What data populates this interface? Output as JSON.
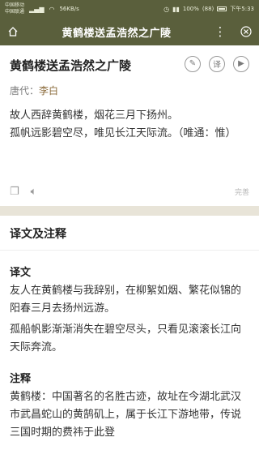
{
  "status_bar": {
    "carrier_1": "中国移动",
    "carrier_2": "中国联通",
    "speed": "56KB/s",
    "battery_text": "100%",
    "time": "下午5:33",
    "extra": "(88)"
  },
  "nav": {
    "title": "黄鹤楼送孟浩然之广陵",
    "home_icon": "home-icon",
    "more_icon": "more-vertical-icon",
    "close_icon": "close-icon"
  },
  "poem": {
    "title": "黄鹤楼送孟浩然之广陵",
    "author_label": "唐代：",
    "author": "李白",
    "body": [
      "故人西辞黄鹤楼，烟花三月下扬州。",
      "孤帆远影碧空尽，唯见长江天际流。（唯通：惟）"
    ],
    "actions": [
      "edit-icon",
      "translate-icon",
      "play-icon"
    ],
    "footer_note": "完善"
  },
  "translation": {
    "section_title": "译文及注释",
    "translation_label": "译文",
    "translation_text": "友人在黄鹤楼与我辞别，在柳絮如烟、繁花似锦的阳春三月去扬州远游。",
    "translation_text_2": "孤船帆影渐渐消失在碧空尽头，只看见滚滚长江向天际奔流。",
    "notes_label": "注释",
    "notes_text": "黄鹤楼：中国著名的名胜古迹，故址在今湖北武汉市武昌蛇山的黄鹄矶上，属于长江下游地带，传说三国时期的费祎于此登"
  }
}
